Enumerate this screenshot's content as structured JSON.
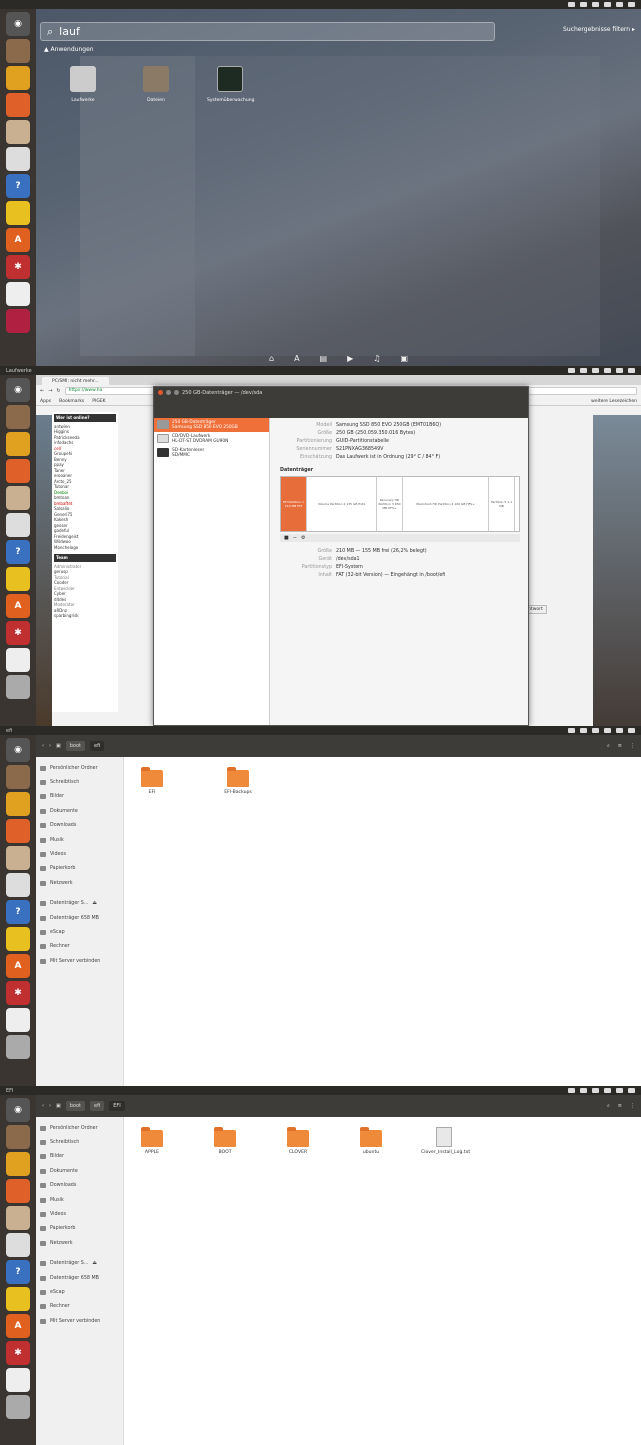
{
  "colors": {
    "accent": "#f0703a",
    "launcher": "#3a3531",
    "topbar": "#2b2a26",
    "folder": "#f08a3b"
  },
  "panel1": {
    "search_value": "lauf",
    "filter_label": "Suchergebnisse filtern ▸",
    "category": "Anwendungen",
    "apps": [
      {
        "label": "Laufwerke",
        "icon": "disks-icon"
      },
      {
        "label": "Dateien",
        "icon": "files-icon"
      },
      {
        "label": "Systemüberwachung",
        "icon": "system-monitor-icon"
      }
    ]
  },
  "panel2": {
    "window_title": "Laufwerke",
    "tab_label": "PC/SMI: nicht mehr...",
    "url": "https://www.ha",
    "bookmarks": [
      "Apps",
      "Bookmarks",
      "PIGEK"
    ],
    "bookmarks_right": "weitere Lesezeichen",
    "forum_header": "Wer ist online?",
    "forum_users": [
      "antwien",
      "Higgins",
      "Patrickseeda",
      "infodachs",
      "cell",
      "Groupehi",
      "Benny",
      "ppay",
      "Taner",
      "erooaner",
      "Arcto_25",
      "Tutonar",
      "Deeboi",
      "bmtoan",
      "bmbaftet",
      "Salsalio",
      "Generi75",
      "Kakesh",
      "geoser",
      "gadeful",
      "Freidengeist",
      "Wildwoo",
      "Monchelogo"
    ],
    "team_header": "Team",
    "team_groups": [
      {
        "label": "Administrator",
        "users": [
          "gerusp"
        ]
      },
      {
        "label": "Tutorial",
        "users": [
          "Cooder"
        ]
      },
      {
        "label": "Entwickler",
        "users": [
          "Cyber",
          "d4des"
        ]
      },
      {
        "label": "Moderator",
        "users": [
          "aRDnz",
          "sparbingrisk"
        ]
      }
    ],
    "disks_title": "250 GB-Datenträger — /dev/sda",
    "devices": [
      {
        "line1": "250 GB-Datenträger",
        "line2": "Samsung SSD 850 EVO 250GB"
      },
      {
        "line1": "CD/DVD-Laufwerk",
        "line2": "HL-DT-ST DVDRAM GU90N"
      },
      {
        "line1": "SD-Kartenleser",
        "line2": "SD/MMC"
      }
    ],
    "info": [
      {
        "k": "Modell",
        "v": "Samsung SSD 850 EVO 250GB (EMT01B6Q)"
      },
      {
        "k": "Größe",
        "v": "250 GB (250.059.350.016 Bytes)"
      },
      {
        "k": "Partitionierung",
        "v": "GUID-Partitionstabelle"
      },
      {
        "k": "Seriennummer",
        "v": "S21PNXAG368549V"
      },
      {
        "k": "Einschätzung",
        "v": "Das Laufwerk ist in Ordnung (29° C / 84° F)"
      }
    ],
    "datentraeger_label": "Datenträger",
    "volumes": [
      {
        "label": "EFI Partition 1 210 MB FAT",
        "sel": true,
        "w": 26
      },
      {
        "label": "Volume Partition 2 135 GB Ext4",
        "sel": false,
        "w": 70
      },
      {
        "label": "Recovery HD Partition 3 650 MB HFS+",
        "sel": false,
        "w": 26
      },
      {
        "label": "Macintosh HD Partition 4 100 GB HFS+",
        "sel": false,
        "w": 86
      },
      {
        "label": "Partition 5 1.1 MB",
        "sel": false,
        "w": 26
      }
    ],
    "vol_info": [
      {
        "k": "Größe",
        "v": "210 MB — 155 MB frei (26,2% belegt)"
      },
      {
        "k": "Gerät",
        "v": "/dev/sda1"
      },
      {
        "k": "Partitionstyp",
        "v": "EFI-System"
      },
      {
        "k": "Inhalt",
        "v": "FAT (32-bit Version) — Eingehängt in /boot/efi"
      }
    ],
    "antwort_label": "Antwort"
  },
  "sidebar_items": [
    {
      "label": "Persönlicher Ordner",
      "icon": "home-icon"
    },
    {
      "label": "Schreibtisch",
      "icon": "desktop-icon"
    },
    {
      "label": "Bilder",
      "icon": "pictures-icon"
    },
    {
      "label": "Dokumente",
      "icon": "documents-icon"
    },
    {
      "label": "Downloads",
      "icon": "downloads-icon"
    },
    {
      "label": "Musik",
      "icon": "music-icon"
    },
    {
      "label": "Videos",
      "icon": "videos-icon"
    },
    {
      "label": "Papierkorb",
      "icon": "trash-icon"
    },
    {
      "label": "Netzwerk",
      "icon": "network-icon"
    },
    {
      "label": "Datenträger S...",
      "icon": "drive-icon"
    },
    {
      "label": "Datenträger 658 MB",
      "icon": "drive-icon"
    },
    {
      "label": "eScap",
      "icon": "drive-icon"
    },
    {
      "label": "Rechner",
      "icon": "computer-icon"
    },
    {
      "label": "Mit Server verbinden",
      "icon": "server-icon"
    }
  ],
  "panel3": {
    "window_title": "efi",
    "crumbs": [
      "boot",
      "efi"
    ],
    "items": [
      "EFI",
      "EFI-Backups"
    ]
  },
  "panel4": {
    "window_title": "EFI",
    "crumbs": [
      "boot",
      "efi",
      "EFI"
    ],
    "items": [
      "APPLE",
      "BOOT",
      "CLOVER",
      "ubuntu",
      "Clover_Install_Log.txt"
    ]
  }
}
